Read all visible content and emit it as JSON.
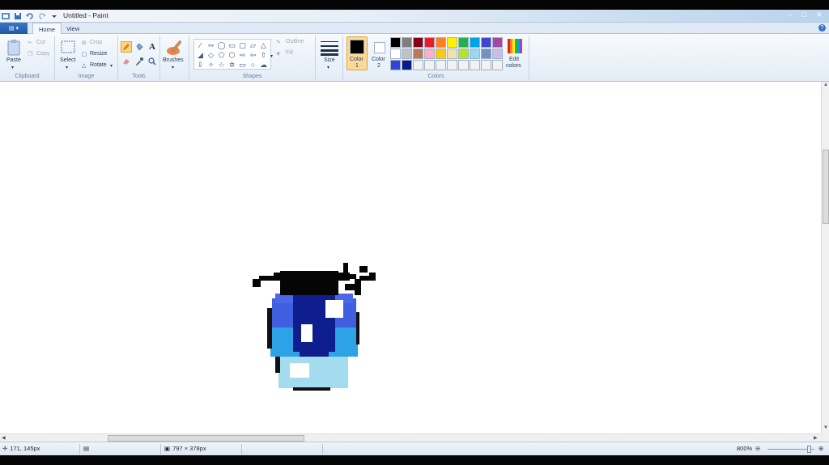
{
  "window": {
    "title": "Untitled - Paint"
  },
  "tabs": {
    "file": "",
    "home": "Home",
    "view": "View"
  },
  "clipboard": {
    "paste": "Paste",
    "cut": "Cut",
    "copy": "Copy",
    "group": "Clipboard"
  },
  "image": {
    "select": "Select",
    "crop": "Crop",
    "resize": "Resize",
    "rotate": "Rotate",
    "group": "Image"
  },
  "tools": {
    "group": "Tools",
    "brushes": "Brushes"
  },
  "shapes": {
    "outline": "Outline",
    "fill": "Fill",
    "group": "Shapes"
  },
  "size": {
    "label": "Size"
  },
  "colors": {
    "color1_line1": "Color",
    "color1_line2": "1",
    "color2_line1": "Color",
    "color2_line2": "2",
    "edit_line1": "Edit",
    "edit_line2": "colors",
    "group": "Colors",
    "primary": "#000000",
    "secondary": "#ffffff",
    "palette": [
      "#000000",
      "#7f7f7f",
      "#880015",
      "#ed1c24",
      "#ff7f27",
      "#fff200",
      "#22b14c",
      "#00a2e8",
      "#3f48cc",
      "#a349a4",
      "#ffffff",
      "#c3c3c3",
      "#b97a57",
      "#ffaec9",
      "#ffc90e",
      "#efe4b0",
      "#b5e61d",
      "#99d9ea",
      "#7092be",
      "#c8bfe7",
      "#3344dd",
      "#0a1a8a",
      "#f2f2f2",
      "#f2f2f2",
      "#f2f2f2",
      "#f2f2f2",
      "#f2f2f2",
      "#f2f2f2",
      "#f2f2f2",
      "#f2f2f2"
    ]
  },
  "status": {
    "cursor_pos": "171, 145px",
    "image_size": "797 × 378px",
    "zoom": "800%"
  }
}
